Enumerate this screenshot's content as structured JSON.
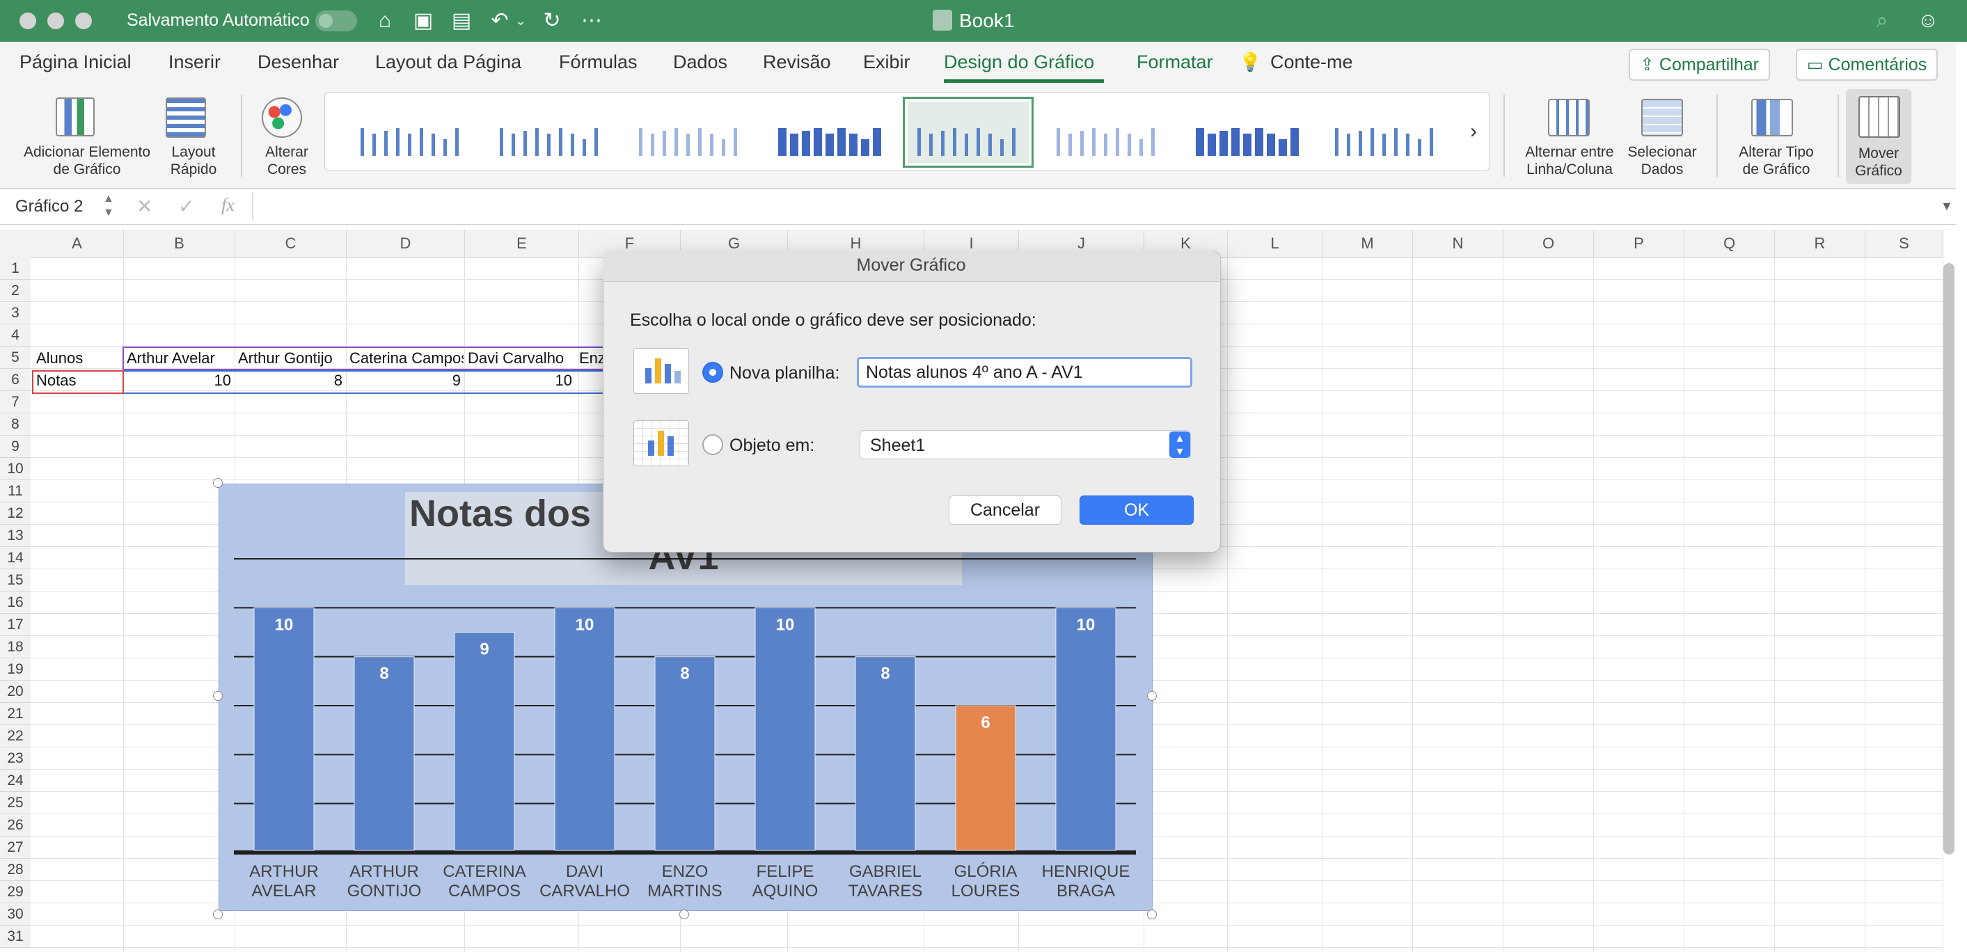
{
  "titlebar": {
    "autosave_label": "Salvamento Automático",
    "doc_title": "Book1"
  },
  "tabs": [
    {
      "label": "Página Inicial"
    },
    {
      "label": "Inserir"
    },
    {
      "label": "Desenhar"
    },
    {
      "label": "Layout da Página"
    },
    {
      "label": "Fórmulas"
    },
    {
      "label": "Dados"
    },
    {
      "label": "Revisão"
    },
    {
      "label": "Exibir"
    },
    {
      "label": "Design do Gráfico",
      "active": true
    },
    {
      "label": "Formatar"
    },
    {
      "label": "Conte-me"
    }
  ],
  "share_label": "Compartilhar",
  "comments_label": "Comentários",
  "ribbon": {
    "add_element_1": "Adicionar Elemento",
    "add_element_2": "de Gráfico",
    "quick_layout_1": "Layout",
    "quick_layout_2": "Rápido",
    "change_colors_1": "Alterar",
    "change_colors_2": "Cores",
    "switch_1": "Alternar entre",
    "switch_2": "Linha/Coluna",
    "select_data_1": "Selecionar",
    "select_data_2": "Dados",
    "change_type_1": "Alterar Tipo",
    "change_type_2": "de Gráfico",
    "move_chart_1": "Mover",
    "move_chart_2": "Gráfico"
  },
  "formula_bar": {
    "name_box": "Gráfico 2",
    "fx": "fx"
  },
  "columns": [
    "A",
    "B",
    "C",
    "D",
    "E",
    "F",
    "G",
    "H",
    "I",
    "J",
    "K",
    "L",
    "M",
    "N",
    "O",
    "P",
    "Q",
    "R",
    "S"
  ],
  "cells": {
    "a5": "Alunos",
    "b5": "Arthur Avelar",
    "c5": "Arthur Gontijo",
    "d5": "Caterina Campos",
    "e5": "Davi Carvalho",
    "f5": "Enz",
    "a6": "Notas",
    "b6": "10",
    "c6": "8",
    "d6": "9",
    "e6": "10"
  },
  "chart_data": {
    "type": "bar",
    "title": "Notas dos alunos 4º ano A - AV1",
    "title_line1_visible": "Notas dos",
    "title_line2_visible": "AV1",
    "categories": [
      [
        "ARTHUR",
        "AVELAR"
      ],
      [
        "ARTHUR",
        "GONTIJO"
      ],
      [
        "CATERINA",
        "CAMPOS"
      ],
      [
        "DAVI",
        "CARVALHO"
      ],
      [
        "ENZO",
        "MARTINS"
      ],
      [
        "FELIPE",
        "AQUINO"
      ],
      [
        "GABRIEL",
        "TAVARES"
      ],
      [
        "GLÓRIA",
        "LOURES"
      ],
      [
        "HENRIQUE",
        "BRAGA"
      ]
    ],
    "values": [
      10,
      8,
      9,
      10,
      8,
      10,
      8,
      6,
      10
    ],
    "highlight_index": 7,
    "ylim": [
      0,
      12
    ],
    "grid": true,
    "colors": {
      "bar": "#5a82c8",
      "highlight": "#e5864e",
      "background": "#b4c6e7"
    }
  },
  "dialog": {
    "title": "Mover Gráfico",
    "prompt": "Escolha o local onde o gráfico deve ser posicionado:",
    "new_sheet_label": "Nova planilha:",
    "new_sheet_value": "Notas alunos 4º ano A - AV1",
    "object_in_label": "Objeto em:",
    "object_in_value": "Sheet1",
    "cancel_label": "Cancelar",
    "ok_label": "OK"
  }
}
